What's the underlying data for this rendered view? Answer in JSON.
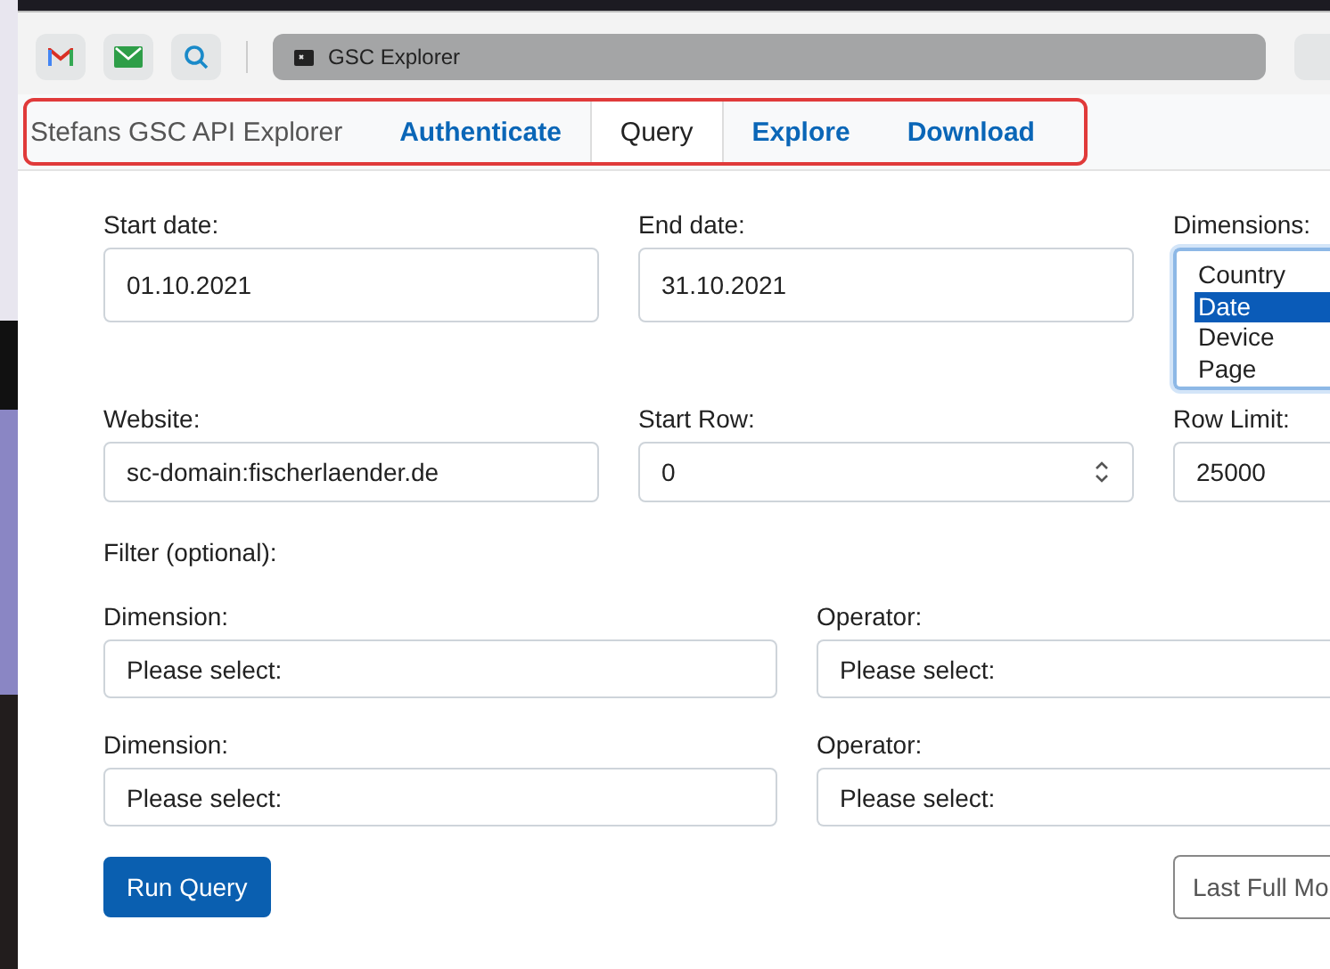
{
  "browser": {
    "bookmarks": [
      {
        "kind": "mail-m"
      },
      {
        "kind": "envelope"
      },
      {
        "kind": "search"
      }
    ],
    "tab_title": "GSC Explorer"
  },
  "navbar": {
    "brand": "Stefans GSC API Explorer",
    "tabs": [
      {
        "label": "Authenticate",
        "selected": false
      },
      {
        "label": "Query",
        "selected": true
      },
      {
        "label": "Explore",
        "selected": false
      },
      {
        "label": "Download",
        "selected": false
      }
    ],
    "highlighted": true
  },
  "form": {
    "start_date": {
      "label": "Start date:",
      "value": "01.10.2021"
    },
    "end_date": {
      "label": "End date:",
      "value": "31.10.2021"
    },
    "dimensions": {
      "label": "Dimensions:",
      "options": [
        {
          "label": "Country",
          "selected": false
        },
        {
          "label": "Date",
          "selected": true
        },
        {
          "label": "Device",
          "selected": false
        },
        {
          "label": "Page",
          "selected": false
        }
      ]
    },
    "website": {
      "label": "Website:",
      "value": "sc-domain:fischerlaender.de"
    },
    "start_row": {
      "label": "Start Row:",
      "value": "0"
    },
    "row_limit": {
      "label": "Row Limit:",
      "value": "25000"
    },
    "filter_label": "Filter (optional):",
    "filters": [
      {
        "dimension_label": "Dimension:",
        "dimension_placeholder": "Please select:",
        "operator_label": "Operator:",
        "operator_placeholder": "Please select:"
      },
      {
        "dimension_label": "Dimension:",
        "dimension_placeholder": "Please select:",
        "operator_label": "Operator:",
        "operator_placeholder": "Please select:"
      }
    ],
    "buttons": [
      {
        "label": "Run Query",
        "kind": "primary"
      },
      {
        "label": "Last Full Mo",
        "kind": "outline"
      }
    ]
  }
}
